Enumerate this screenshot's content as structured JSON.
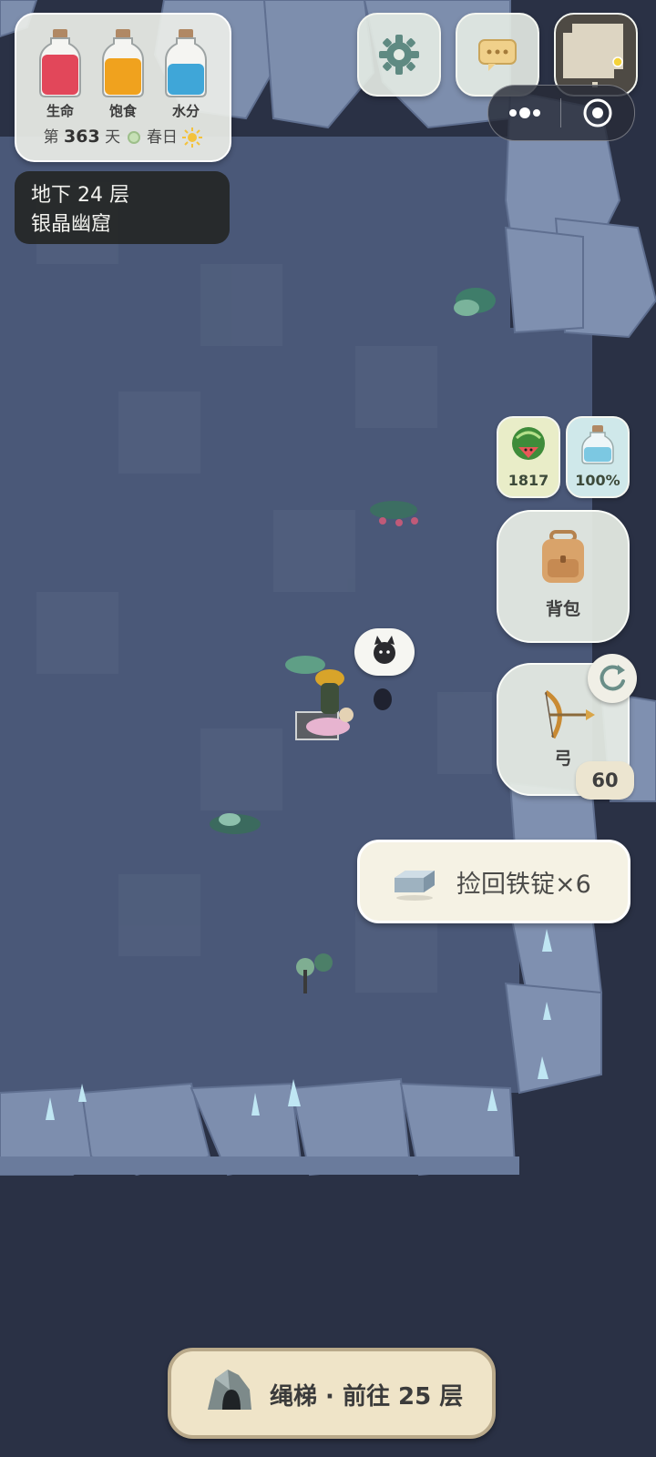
{
  "stats": {
    "health_label": "生命",
    "hunger_label": "饱食",
    "water_label": "水分",
    "day_prefix": "第",
    "day_number": "363",
    "day_suffix": "天",
    "season": "春日",
    "health_level": 0.78,
    "hunger_level": 0.72,
    "water_level": 0.6,
    "colors": {
      "health": "#e2475a",
      "hunger": "#f0a21e",
      "water": "#3fa6d8"
    }
  },
  "location": {
    "floor": "地下 24 层",
    "area": "银晶幽窟"
  },
  "top_buttons": {
    "settings_icon": "gear-icon",
    "chat_icon": "chat-bubble-icon",
    "minimap_icon": "minimap"
  },
  "resources": {
    "food_icon": "watermelon-icon",
    "food_value": "1817",
    "water_icon": "water-bottle-icon",
    "water_value": "100%"
  },
  "backpack": {
    "label": "背包",
    "icon": "backpack-icon"
  },
  "weapon": {
    "label": "弓",
    "ammo": "60",
    "icon": "bow-icon"
  },
  "toast": {
    "text": "捡回铁锭×6",
    "icon": "iron-ingot-icon"
  },
  "ladder_button": {
    "text": "绳梯 · 前往 25 层",
    "icon": "cave-entrance-icon"
  }
}
